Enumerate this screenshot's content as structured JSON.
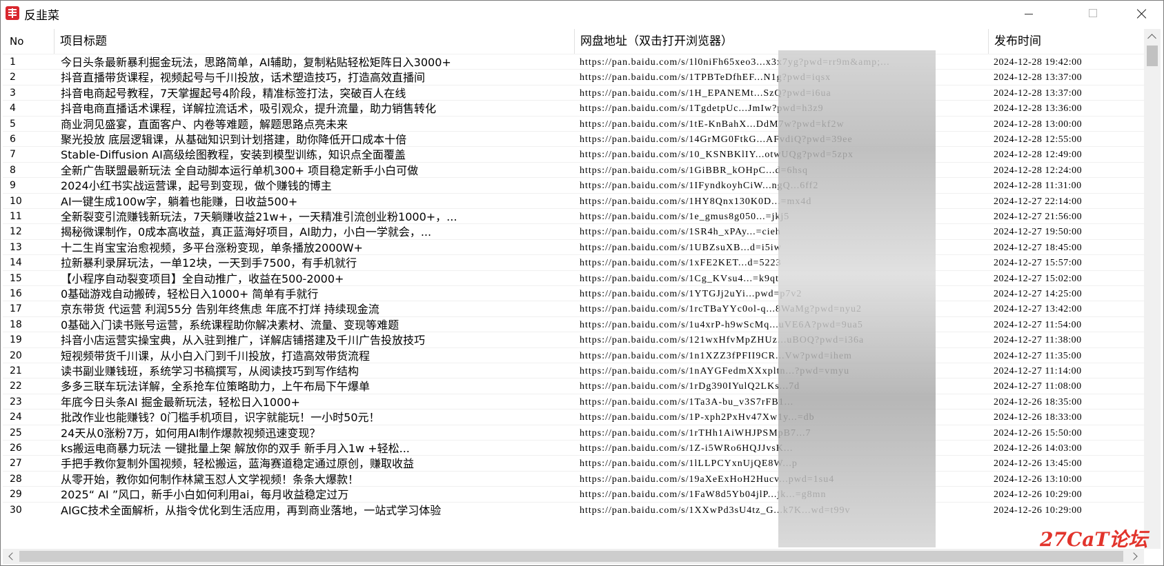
{
  "window": {
    "title": "反韭菜"
  },
  "grid": {
    "columns": {
      "no": "No",
      "title": "项目标题",
      "url": "网盘地址（双击打开浏览器）",
      "date": "发布时间"
    },
    "rows": [
      {
        "no": "1",
        "title": "今日头条最新暴利掘金玩法，思路简单，AI辅助，复制粘贴轻松矩阵日入3000+",
        "url": "https://pan.baidu.com/s/1l0niFh65xeo3...x3x7yg?pwd=rr9m&amp;...",
        "date": "2024-12-28 19:42:00"
      },
      {
        "no": "2",
        "title": "抖音直播带货课程，视频起号与千川投放，话术塑造技巧，打造高效直播间",
        "url": "https://pan.baidu.com/s/1TPBTeDfhEF...N1g?pwd=iqsx",
        "date": "2024-12-28 13:37:00"
      },
      {
        "no": "3",
        "title": "抖音电商起号教程，7天掌握起号4阶段，精准标签打法，突破百人在线",
        "url": "https://pan.baidu.com/s/1H_EPANEMt...SzQ?pwd=i6ua",
        "date": "2024-12-28 13:37:00"
      },
      {
        "no": "4",
        "title": "抖音电商直播话术课程，详解拉流话术，吸引观众，提升流量，助力销售转化",
        "url": "https://pan.baidu.com/s/1TgdetpUc...JmIw?pwd=h3z9",
        "date": "2024-12-28 13:36:00"
      },
      {
        "no": "5",
        "title": "商业洞见盛宴，直面客户、内卷等难题，解题思路点亮未来",
        "url": "https://pan.baidu.com/s/1tE-KnBahX...DdM7w?pwd=kf2w",
        "date": "2024-12-28 13:00:00"
      },
      {
        "no": "6",
        "title": "聚光投放 底层逻辑课，从基础知识到计划搭建，助你降低开口成本十倍",
        "url": "https://pan.baidu.com/s/14GrMG0FtkG...AFvdiQ?pwd=39ee",
        "date": "2024-12-28 12:55:00"
      },
      {
        "no": "7",
        "title": "Stable-Diffusion AI高级绘图教程，安装到模型训练，知识点全面覆盖",
        "url": "https://pan.baidu.com/s/10_KSNBKlIY...otwUQg?pwd=5zpx",
        "date": "2024-12-28 12:49:00"
      },
      {
        "no": "8",
        "title": "全新广告联盟最新玩法 全自动脚本运行单机300+ 项目稳定新手小白可做",
        "url": "https://pan.baidu.com/s/1GiBBR_kOHpC...d=6hsq",
        "date": "2024-12-28 12:24:00"
      },
      {
        "no": "9",
        "title": "2024小红书实战运营课，起号到变现，做个赚钱的博主",
        "url": "https://pan.baidu.com/s/1IFyndkoyhCiW...ngQ...6ff2",
        "date": "2024-12-28 11:31:00"
      },
      {
        "no": "10",
        "title": "AI一键生成100w字，躺着也能赚，日收益500+",
        "url": "https://pan.baidu.com/s/1HY8Qnx130K0D...=mx4d",
        "date": "2024-12-27 22:14:00"
      },
      {
        "no": "11",
        "title": "全新裂变引流赚钱新玩法，7天躺赚收益21w+，一天精准引流创业粉1000+，...",
        "url": "https://pan.baidu.com/s/1e_gmus8g050...=jkj5",
        "date": "2024-12-27 21:56:00"
      },
      {
        "no": "12",
        "title": "揭秘微课制作，0成本高收益，真正蓝海好项目，AI助力，小白一学就会，...",
        "url": "https://pan.baidu.com/s/1SR4h_xPAy...=cieh",
        "date": "2024-12-27 19:50:00"
      },
      {
        "no": "13",
        "title": "十二生肖宝宝治愈视频，多平台涨粉变现，单条播放2000W+",
        "url": "https://pan.baidu.com/s/1UBZsuXB...d=i5iw",
        "date": "2024-12-27 18:45:00"
      },
      {
        "no": "14",
        "title": "拉新暴利录屏玩法，一单12块，一天到手7500，有手机就行",
        "url": "https://pan.baidu.com/s/1xFE2KET...d=5223",
        "date": "2024-12-27 15:57:00"
      },
      {
        "no": "15",
        "title": "【小程序自动裂变项目】全自动推广，收益在500-2000+",
        "url": "https://pan.baidu.com/s/1Cg_KVsu4...=k9qt",
        "date": "2024-12-27 15:02:00"
      },
      {
        "no": "16",
        "title": "0基础游戏自动搬砖，轻松日入1000+ 简单有手就行",
        "url": "https://pan.baidu.com/s/1YTGJj2uYi...pwd=p7v2",
        "date": "2024-12-27 14:25:00"
      },
      {
        "no": "17",
        "title": "京东带货 代运营 利润55分 告别年终焦虑 年底不打烊 持续现金流",
        "url": "https://pan.baidu.com/s/1rcTBaYYc0ol-q...8WaMg?pwd=nyu2",
        "date": "2024-12-27 13:42:00"
      },
      {
        "no": "18",
        "title": "0基础入门读书账号运营，系统课程助你解决素材、流量、变现等难题",
        "url": "https://pan.baidu.com/s/1u4xrP-h9wScMq...uVE6A?pwd=9ua5",
        "date": "2024-12-27 11:54:00"
      },
      {
        "no": "19",
        "title": "抖音小店运营实操宝典，从入驻到推广，详解店铺搭建及千川广告投放技巧",
        "url": "https://pan.baidu.com/s/121wxHfvMpZHUz...uBOQ?pwd=i36a",
        "date": "2024-12-27 11:38:00"
      },
      {
        "no": "20",
        "title": "短视频带货千川课，从小白入门到千川投放，打造高效带货流程",
        "url": "https://pan.baidu.com/s/1n1XZZ3fPFII9CR...Vw?pwd=ihem",
        "date": "2024-12-27 11:35:00"
      },
      {
        "no": "21",
        "title": "读书副业赚钱班，系统学习书稿撰写，从阅读技巧到写作结构",
        "url": "https://pan.baidu.com/s/1nAYGFedmXXxpltn...?pwd=vmyu",
        "date": "2024-12-27 11:14:00"
      },
      {
        "no": "22",
        "title": "多多三联车玩法详解，全系抢车位策略助力，上午布局下午爆单",
        "url": "https://pan.baidu.com/s/1rDg390IYulQ2LKs...7d",
        "date": "2024-12-27 11:08:00"
      },
      {
        "no": "23",
        "title": "年底今日头条AI 掘金最新玩法，轻松日入1000+",
        "url": "https://pan.baidu.com/s/1Ta3A-bu_v3S7rFB1...",
        "date": "2024-12-26 18:35:00"
      },
      {
        "no": "24",
        "title": "批改作业也能赚钱？0门槛手机项目，识字就能玩！一小时50元！",
        "url": "https://pan.baidu.com/s/1P-xph2PxHv47Xw1y...=db",
        "date": "2024-12-26 18:33:00"
      },
      {
        "no": "25",
        "title": "24天从0涨粉7万，如何用AI制作爆款视频迅速变现？",
        "url": "https://pan.baidu.com/s/1rTHh1AiWHJPSMpB7...7",
        "date": "2024-12-26 15:50:00"
      },
      {
        "no": "26",
        "title": "ks搬运电商暴力玩法   一键批量上架 解放你的双手   新手月入1w +轻松...",
        "url": "https://pan.baidu.com/s/1Z-i5WRo6HQJJvsK...",
        "date": "2024-12-26 14:03:00"
      },
      {
        "no": "27",
        "title": "手把手教你复制外国视频，轻松搬运，蓝海赛道稳定通过原创，赚取收益",
        "url": "https://pan.baidu.com/s/1lLLPCYxnUjQE8W...p",
        "date": "2024-12-26 13:45:00"
      },
      {
        "no": "28",
        "title": "从零开始，教你如何制作林黛玉怼人文学视频！条条大爆款！",
        "url": "https://pan.baidu.com/s/19aXeExHoH2Hucv...pwd=1su4",
        "date": "2024-12-26 13:10:00"
      },
      {
        "no": "29",
        "title": "2025“ AI ”风口，新手小白如何利用ai，每月收益稳定过万",
        "url": "https://pan.baidu.com/s/1FaW8d5Yb04jlP...jk...=g8mn",
        "date": "2024-12-26 10:29:00"
      },
      {
        "no": "30",
        "title": "AIGC技术全面解析，从指令优化到生活应用，再到商业落地，一站式学习体验",
        "url": "https://pan.baidu.com/s/1XXwPd3sU4tz_G...k7K...wd=t99v",
        "date": "2024-12-26 10:29:00"
      }
    ]
  },
  "watermark": {
    "text": "27CaT论坛",
    "color": "#e2342c"
  }
}
